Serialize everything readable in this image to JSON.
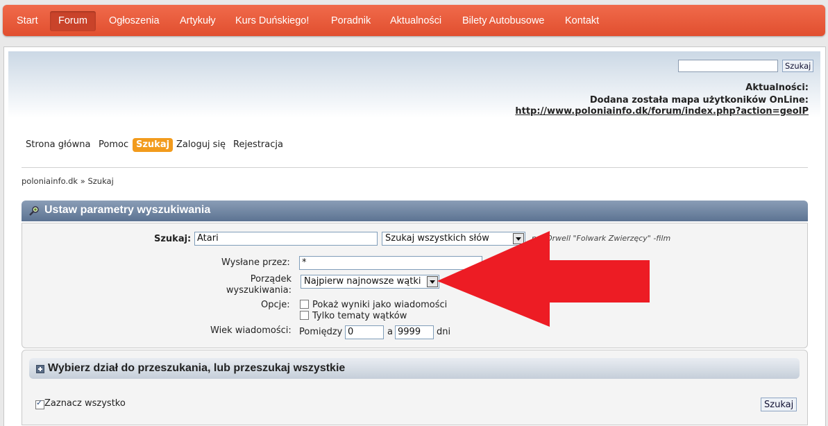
{
  "topnav": {
    "items": [
      "Start",
      "Forum",
      "Ogłoszenia",
      "Artykuły",
      "Kurs Duńskiego!",
      "Poradnik",
      "Aktualności",
      "Bilety Autobusowe",
      "Kontakt"
    ],
    "active": "Forum"
  },
  "header": {
    "search_value": "",
    "search_button": "Szukaj",
    "news_title": "Aktualności:",
    "news_text": "Dodana została mapa użytkoników OnLine:",
    "news_link": "http://www.poloniainfo.dk/forum/index.php?action=geoIP"
  },
  "usermenu": {
    "items": [
      "Strona główna",
      "Pomoc",
      "Szukaj",
      "Zaloguj się",
      "Rejestracja"
    ],
    "active": "Szukaj"
  },
  "breadcrumb": {
    "home": "poloniainfo.dk",
    "separator": "»",
    "current": "Szukaj"
  },
  "params": {
    "title": "Ustaw parametry wyszukiwania",
    "search_label": "Szukaj:",
    "search_value": "Atari",
    "match_select": "Szukaj wszystkich słów",
    "hint": "np. Orwell \"Folwark Zwierzęcy\" -film",
    "posted_by_label": "Wysłane przez:",
    "posted_by_value": "*",
    "order_label_1": "Porządek",
    "order_label_2": "wyszukiwania:",
    "order_select": "Najpierw najnowsze wątki",
    "options_label": "Opcje:",
    "option_1": "Pokaż wyniki jako wiadomości",
    "option_2": "Tylko tematy wątków",
    "age_label": "Wiek wiadomości:",
    "age_between": "Pomiędzy",
    "age_from": "0",
    "age_and": "a",
    "age_to": "9999",
    "age_unit": "dni"
  },
  "boards": {
    "title": "Wybierz dział do przeszukania, lub przeszukaj wszystkie",
    "select_all": "Zaznacz wszystko",
    "submit": "Szukaj"
  },
  "colors": {
    "topbar": "#e14f2f",
    "accent": "#f29b1d",
    "panel_header": "#5c7392",
    "arrow": "#ed1c24"
  }
}
